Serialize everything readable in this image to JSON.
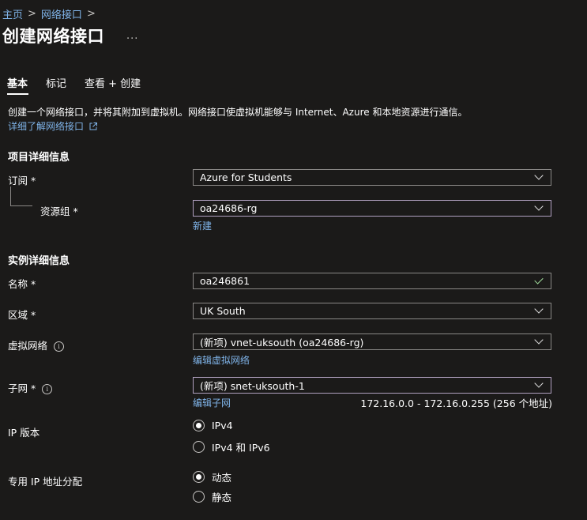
{
  "breadcrumb": {
    "home": "主页",
    "sep": ">",
    "parent": "网络接口",
    "sep2": ">"
  },
  "page": {
    "title": "创建网络接口",
    "more": "..."
  },
  "tabs": [
    {
      "label": "基本"
    },
    {
      "label": "标记"
    },
    {
      "label": "查看 + 创建"
    }
  ],
  "intro": {
    "description": "创建一个网络接口，并将其附加到虚拟机。网络接口使虚拟机能够与 Internet、Azure 和本地资源进行通信。",
    "learn_more": "详细了解网络接口"
  },
  "project": {
    "heading": "项目详细信息",
    "subscription": {
      "label": "订阅",
      "required": "*",
      "value": "Azure for Students"
    },
    "resource_group": {
      "label": "资源组",
      "required": "*",
      "value": "oa24686-rg",
      "create_new": "新建"
    }
  },
  "instance": {
    "heading": "实例详细信息",
    "name": {
      "label": "名称",
      "required": "*",
      "value": "oa246861"
    },
    "region": {
      "label": "区域",
      "required": "*",
      "value": "UK South"
    },
    "vnet": {
      "label": "虚拟网络",
      "value": "(新项) vnet-uksouth (oa24686-rg)",
      "edit": "编辑虚拟网络"
    },
    "subnet": {
      "label": "子网",
      "required": "*",
      "value": "(新项) snet-uksouth-1",
      "edit": "编辑子网",
      "range": "172.16.0.0 - 172.16.0.255 (256 个地址)"
    },
    "ip_version": {
      "label": "IP 版本",
      "options": [
        "IPv4",
        "IPv4 和 IPv6"
      ],
      "selected": "IPv4"
    },
    "ip_allocation": {
      "label": "专用 IP 地址分配",
      "options": [
        "动态",
        "静态"
      ],
      "selected": "动态"
    }
  },
  "icons": {
    "info": "info-icon",
    "external": "external-link-icon",
    "chevron": "chevron-down-icon",
    "check": "checkmark-icon"
  },
  "colors": {
    "background": "#1b1a19",
    "link": "#7fb3e8",
    "valid": "#a6e3a1"
  }
}
